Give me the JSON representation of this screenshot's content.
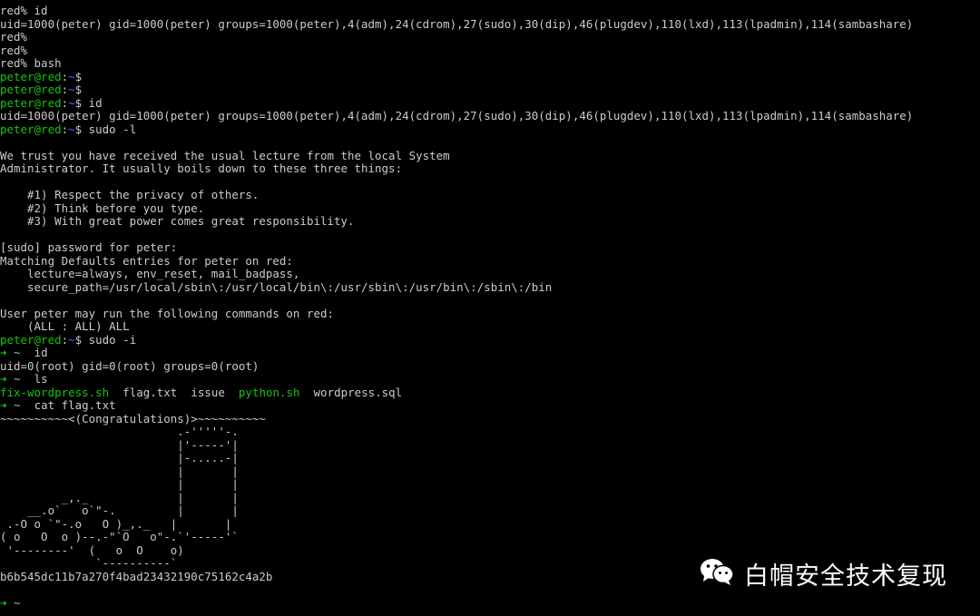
{
  "terminal": {
    "prompt_user": "peter@red",
    "lines": [
      {
        "k": "plain",
        "t": "red% id"
      },
      {
        "k": "plain",
        "t": "uid=1000(peter) gid=1000(peter) groups=1000(peter),4(adm),24(cdrom),27(sudo),30(dip),46(plugdev),110(lxd),113(lpadmin),114(sambashare)"
      },
      {
        "k": "plain",
        "t": "red%"
      },
      {
        "k": "plain",
        "t": "red%"
      },
      {
        "k": "plain",
        "t": "red% bash"
      },
      {
        "k": "prompt",
        "cmd": ""
      },
      {
        "k": "prompt",
        "cmd": ""
      },
      {
        "k": "prompt",
        "cmd": " id"
      },
      {
        "k": "plain",
        "t": "uid=1000(peter) gid=1000(peter) groups=1000(peter),4(adm),24(cdrom),27(sudo),30(dip),46(plugdev),110(lxd),113(lpadmin),114(sambashare)"
      },
      {
        "k": "prompt",
        "cmd": " sudo -l"
      },
      {
        "k": "plain",
        "t": ""
      },
      {
        "k": "plain",
        "t": "We trust you have received the usual lecture from the local System"
      },
      {
        "k": "plain",
        "t": "Administrator. It usually boils down to these three things:"
      },
      {
        "k": "plain",
        "t": ""
      },
      {
        "k": "plain",
        "t": "    #1) Respect the privacy of others."
      },
      {
        "k": "plain",
        "t": "    #2) Think before you type."
      },
      {
        "k": "plain",
        "t": "    #3) With great power comes great responsibility."
      },
      {
        "k": "plain",
        "t": ""
      },
      {
        "k": "plain",
        "t": "[sudo] password for peter:"
      },
      {
        "k": "plain",
        "t": "Matching Defaults entries for peter on red:"
      },
      {
        "k": "plain",
        "t": "    lecture=always, env_reset, mail_badpass,"
      },
      {
        "k": "plain",
        "t": "    secure_path=/usr/local/sbin\\:/usr/local/bin\\:/usr/sbin\\:/usr/bin\\:/sbin\\:/bin"
      },
      {
        "k": "plain",
        "t": ""
      },
      {
        "k": "plain",
        "t": "User peter may run the following commands on red:"
      },
      {
        "k": "plain",
        "t": "    (ALL : ALL) ALL"
      },
      {
        "k": "prompt",
        "cmd": " sudo -i"
      },
      {
        "k": "zsh",
        "cmd": "  id"
      },
      {
        "k": "plain",
        "t": "uid=0(root) gid=0(root) groups=0(root)"
      },
      {
        "k": "zsh",
        "cmd": "  ls"
      },
      {
        "k": "ls",
        "files": [
          {
            "name": "fix-wordpress.sh",
            "exe": true
          },
          {
            "name": "flag.txt",
            "exe": false
          },
          {
            "name": "issue",
            "exe": false
          },
          {
            "name": "python.sh",
            "exe": true
          },
          {
            "name": "wordpress.sql",
            "exe": false
          }
        ]
      },
      {
        "k": "zsh",
        "cmd": "  cat flag.txt"
      },
      {
        "k": "plain",
        "t": "~~~~~~~~~~<(Congratulations)>~~~~~~~~~~"
      },
      {
        "k": "plain",
        "t": "                          .-'''''-."
      },
      {
        "k": "plain",
        "t": "                          |'-----'|"
      },
      {
        "k": "plain",
        "t": "                          |-.....-|"
      },
      {
        "k": "plain",
        "t": "                          |       |"
      },
      {
        "k": "plain",
        "t": "                          |       |"
      },
      {
        "k": "plain",
        "t": "         _,._             |       |"
      },
      {
        "k": "plain",
        "t": "    __.o`   o`\"-.         |       |"
      },
      {
        "k": "plain",
        "t": " .-O o `\"-.o   O )_,._   |       |"
      },
      {
        "k": "plain",
        "t": "( o   O  o )--.-\"`O   o\"-.`'-----'`"
      },
      {
        "k": "plain",
        "t": " '--------'  (   o  O    o)"
      },
      {
        "k": "plain",
        "t": "              `----------`"
      },
      {
        "k": "plain",
        "t": "b6b545dc11b7a270f4bad23432190c75162c4a2b"
      },
      {
        "k": "plain",
        "t": ""
      },
      {
        "k": "zsh",
        "cmd": ""
      }
    ]
  },
  "watermark": {
    "text": "白帽安全技术复现",
    "icon": "wechat-icon"
  },
  "colors": {
    "background": "#000000",
    "text": "#cccccc",
    "user": "#16c60c",
    "path": "#3b78ff",
    "arrow": "#16c60c",
    "tilde": "#61d6d6"
  }
}
